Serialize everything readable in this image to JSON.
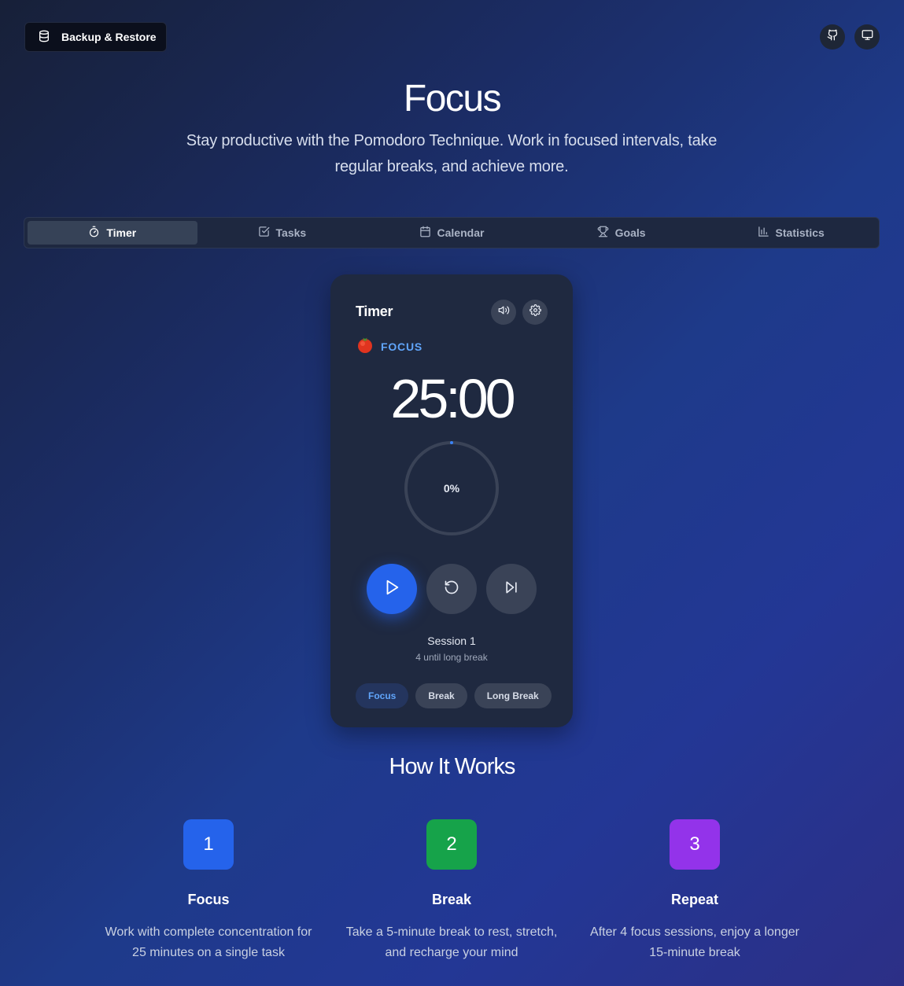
{
  "header": {
    "backup_label": "Backup & Restore",
    "icons": [
      "github-icon",
      "monitor-icon"
    ]
  },
  "hero": {
    "title": "Focus",
    "subtitle_line1": "Stay productive with the Pomodoro Technique. Work in focused intervals, take",
    "subtitle_line2": "regular breaks, and achieve more."
  },
  "tabs": [
    {
      "label": "Timer",
      "icon": "timer-icon",
      "active": true
    },
    {
      "label": "Tasks",
      "icon": "checkbox-icon",
      "active": false
    },
    {
      "label": "Calendar",
      "icon": "calendar-icon",
      "active": false
    },
    {
      "label": "Goals",
      "icon": "trophy-icon",
      "active": false
    },
    {
      "label": "Statistics",
      "icon": "bar-chart-icon",
      "active": false
    }
  ],
  "timer": {
    "title": "Timer",
    "mode": "FOCUS",
    "time": "25:00",
    "progress_label": "0%",
    "progress": 0,
    "session": "Session 1",
    "until_long_break": "4 until long break",
    "modes": [
      "Focus",
      "Break",
      "Long Break"
    ],
    "active_mode": "Focus"
  },
  "how": {
    "title": "How It Works",
    "steps": [
      {
        "num": "1",
        "title": "Focus",
        "desc_line1": "Work with complete concentration for",
        "desc_line2": "25 minutes on a single task",
        "color": "#2563eb"
      },
      {
        "num": "2",
        "title": "Break",
        "desc_line1": "Take a 5-minute break to rest, stretch,",
        "desc_line2": "and recharge your mind",
        "color": "#16a34a"
      },
      {
        "num": "3",
        "title": "Repeat",
        "desc_line1": "After 4 focus sessions, enjoy a longer",
        "desc_line2": "15-minute break",
        "color": "#9333ea"
      }
    ]
  }
}
